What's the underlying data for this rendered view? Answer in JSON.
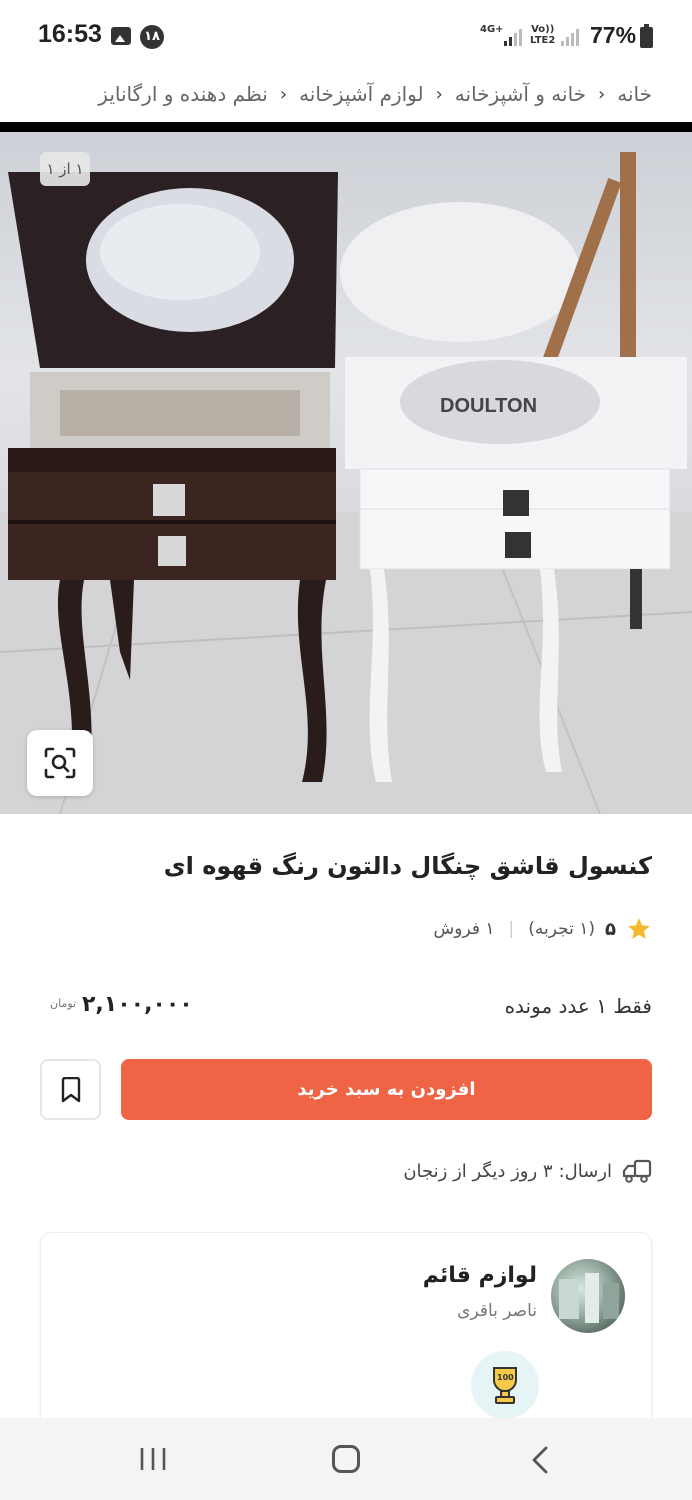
{
  "status_bar": {
    "time": "16:53",
    "notification_count": "۱۸",
    "network": "4G+",
    "lte_top": "Vo))",
    "lte_bottom": "LTE2",
    "battery": "77%"
  },
  "breadcrumb": {
    "items": [
      "خانه",
      "خانه و آشپزخانه",
      "لوازم آشپزخانه",
      "نظم دهنده و ارگانایز"
    ]
  },
  "gallery": {
    "counter": "۱ از ۱",
    "image_label": "DOULTON"
  },
  "product": {
    "title": "کنسول قاشق چنگال دالتون رنگ قهوه ای",
    "rating": "۵",
    "rating_count": "(۱ تجربه)",
    "sales": "۱ فروش",
    "stock": "فقط ۱ عدد مونده",
    "price": "۲,۱۰۰,۰۰۰",
    "currency": "تومان",
    "add_to_cart": "افزودن به سبد خرید",
    "shipping_label": "ارسال:",
    "shipping_value": "۳ روز دیگر از زنجان"
  },
  "seller": {
    "name": "لوازم قائم",
    "owner": "ناصر باقری",
    "badge": "100"
  },
  "colors": {
    "accent": "#ef6444",
    "star": "#f5b82e"
  },
  "icons": {
    "zoom": "image-search-icon",
    "bookmark": "bookmark-icon",
    "truck": "truck-icon",
    "star": "star-icon"
  }
}
